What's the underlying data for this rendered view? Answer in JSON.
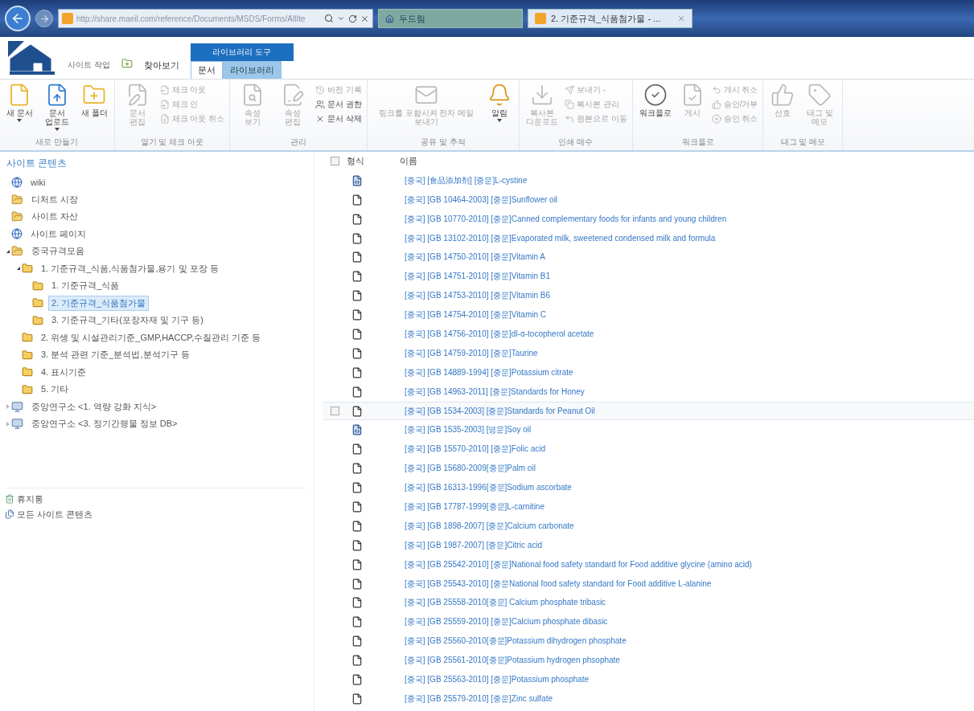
{
  "browser": {
    "address": "http://share.maeil.com/reference/Documents/MSDS/Forms/AllIte",
    "tabs": [
      {
        "label": "두드림",
        "selected": false
      },
      {
        "label": "2. 기준규격_식품첨가물 - ...",
        "selected": true
      }
    ]
  },
  "ribbon": {
    "site_actions": "사이트 작업",
    "browse": "찾아보기",
    "tool_group": "라이브러리 도구",
    "tabs": [
      {
        "label": "문서",
        "selected": true
      },
      {
        "label": "라이브러리",
        "selected": false
      }
    ],
    "groups": [
      {
        "label": "새로 만들기",
        "items": [
          {
            "kind": "large",
            "label": "새 문서",
            "dropdown": true,
            "disabled": false
          },
          {
            "kind": "large",
            "label": "문서 업로드",
            "dropdown": true,
            "disabled": false
          },
          {
            "kind": "large",
            "label": "새 폴더",
            "dropdown": false,
            "disabled": false
          }
        ]
      },
      {
        "label": "열기 및 체크 아웃",
        "items": [
          {
            "kind": "large",
            "label": "문서 편집",
            "dropdown": false,
            "disabled": true
          },
          {
            "kind": "small",
            "label": "체크 아웃",
            "dropdown": false,
            "disabled": true
          },
          {
            "kind": "small",
            "label": "체크 인",
            "dropdown": false,
            "disabled": true
          },
          {
            "kind": "small",
            "label": "체크 아웃 취소",
            "dropdown": false,
            "disabled": true
          }
        ]
      },
      {
        "label": "관리",
        "items": [
          {
            "kind": "large",
            "label": "속성 보기",
            "dropdown": false,
            "disabled": true
          },
          {
            "kind": "large",
            "label": "속성 편집",
            "dropdown": false,
            "disabled": true
          },
          {
            "kind": "small",
            "label": "버전 기록",
            "dropdown": false,
            "disabled": true
          },
          {
            "kind": "small",
            "label": "문서 권한",
            "dropdown": false,
            "disabled": false
          },
          {
            "kind": "small",
            "label": "문서 삭제",
            "dropdown": false,
            "disabled": false
          }
        ]
      },
      {
        "label": "공유 및 추적",
        "items": [
          {
            "kind": "large",
            "label": "링크를 포함시켜 전자 메일 보내기",
            "dropdown": false,
            "disabled": true
          },
          {
            "kind": "large",
            "label": "알림",
            "dropdown": true,
            "disabled": false
          }
        ]
      },
      {
        "label": "인쇄 매수",
        "items": [
          {
            "kind": "large",
            "label": "복사본 다운로드",
            "dropdown": false,
            "disabled": true
          },
          {
            "kind": "small",
            "label": "보내기 -",
            "dropdown": false,
            "disabled": true
          },
          {
            "kind": "small",
            "label": "복사본 관리",
            "dropdown": false,
            "disabled": true
          },
          {
            "kind": "small",
            "label": "원본으로 이동",
            "dropdown": false,
            "disabled": true
          }
        ]
      },
      {
        "label": "워크플로",
        "items": [
          {
            "kind": "large",
            "label": "워크플로",
            "dropdown": false,
            "disabled": false
          },
          {
            "kind": "large",
            "label": "게시",
            "dropdown": false,
            "disabled": true
          },
          {
            "kind": "small",
            "label": "게시 취소",
            "dropdown": false,
            "disabled": true
          },
          {
            "kind": "small",
            "label": "승인/거부",
            "dropdown": false,
            "disabled": true
          },
          {
            "kind": "small",
            "label": "승인 취소",
            "dropdown": false,
            "disabled": true
          }
        ]
      },
      {
        "label": "태그 및 메모",
        "items": [
          {
            "kind": "large",
            "label": "선호",
            "dropdown": false,
            "disabled": true
          },
          {
            "kind": "large",
            "label": "태그 및 메모",
            "dropdown": false,
            "disabled": true
          }
        ]
      }
    ]
  },
  "nav": {
    "heading": "사이트 콘텐츠",
    "items": [
      {
        "kind": "page",
        "label": "wiki",
        "selected": false
      },
      {
        "kind": "library",
        "label": "디처트 시장",
        "selected": false
      },
      {
        "kind": "library",
        "label": "사이트 자산",
        "selected": false
      },
      {
        "kind": "page",
        "label": "사이트 페이지",
        "selected": false
      },
      {
        "kind": "library",
        "label": "중국규격모음",
        "selected": false,
        "expanded": true,
        "children": [
          {
            "kind": "folder",
            "label": "1. 기준규격_식품,식품첨가물,용기 및 포장 등",
            "selected": false,
            "expanded": true,
            "children": [
              {
                "kind": "folder",
                "label": "1. 기준규격_식품",
                "selected": false
              },
              {
                "kind": "folder",
                "label": "2. 기준규격_식품첨가물",
                "selected": true
              },
              {
                "kind": "folder",
                "label": "3. 기준규격_기타(포장자재 및 기구 등)",
                "selected": false
              }
            ]
          },
          {
            "kind": "folder",
            "label": "2. 위생 및 시설관리기준_GMP,HACCP,수질관리 기준 등",
            "selected": false
          },
          {
            "kind": "folder",
            "label": "3. 분석 관련 기준_분석법,분석기구 등",
            "selected": false
          },
          {
            "kind": "folder",
            "label": "4. 표시기준",
            "selected": false
          },
          {
            "kind": "folder",
            "label": "5. 기타",
            "selected": false
          }
        ]
      },
      {
        "kind": "site",
        "label": "중앙연구소 <1. 역량 강화 지식>",
        "selected": false,
        "expanded": false
      },
      {
        "kind": "site",
        "label": "중앙연구소 <3. 정기간행물 정보 DB>",
        "selected": false,
        "expanded": false
      }
    ],
    "footer": [
      "휴지통",
      "모든 사이트 콘텐츠"
    ]
  },
  "list": {
    "select_all": {
      "checked": false
    },
    "columns": [
      "형식",
      "이름"
    ],
    "rows": [
      {
        "kind": "html",
        "name": "[중국] [食品添加剂] [중문]L-cystine",
        "hovered": false
      },
      {
        "kind": "doc",
        "name": "[중국] [GB 10464-2003] [중문]Sunflower oil",
        "hovered": false
      },
      {
        "kind": "doc",
        "name": "[중국] [GB 10770-2010] [중문]Canned complementary foods for infants and young children",
        "hovered": false
      },
      {
        "kind": "doc",
        "name": "[중국] [GB 13102-2010] [중문]Evaporated milk, sweetened condensed milk and formula",
        "hovered": false
      },
      {
        "kind": "doc",
        "name": "[중국] [GB 14750-2010] [중문]Vitamin A",
        "hovered": false
      },
      {
        "kind": "doc",
        "name": "[중국] [GB 14751-2010] [중문]Vitamin B1",
        "hovered": false
      },
      {
        "kind": "doc",
        "name": "[중국] [GB 14753-2010] [중문]Vitamin B6",
        "hovered": false
      },
      {
        "kind": "doc",
        "name": "[중국] [GB 14754-2010] [중문]Vitamin C",
        "hovered": false
      },
      {
        "kind": "doc",
        "name": "[중국] [GB 14756-2010] [중문]dl-α-tocopherol acetate",
        "hovered": false
      },
      {
        "kind": "doc",
        "name": "[중국] [GB 14759-2010] [중문]Taurine",
        "hovered": false
      },
      {
        "kind": "doc",
        "name": "[중국] [GB 14889-1994] [중문]Potassium citrate",
        "hovered": false
      },
      {
        "kind": "doc",
        "name": "[중국] [GB 14963-2011] [중문]Standards for Honey",
        "hovered": false
      },
      {
        "kind": "doc",
        "name": "[중국] [GB 1534-2003] [중문]Standards for Peanut Oil",
        "hovered": true
      },
      {
        "kind": "html",
        "name": "[중국] [GB 1535-2003] [영문]Soy oil",
        "hovered": false
      },
      {
        "kind": "doc",
        "name": "[중국] [GB 15570-2010] [중문]Folic acid",
        "hovered": false
      },
      {
        "kind": "doc",
        "name": "[중국] [GB 15680-2009[중문]Palm oil",
        "hovered": false
      },
      {
        "kind": "doc",
        "name": "[중국] [GB 16313-1996[중문]Sodium ascorbate",
        "hovered": false
      },
      {
        "kind": "doc",
        "name": "[중국] [GB 17787-1999[중문]L-carnitine",
        "hovered": false
      },
      {
        "kind": "doc",
        "name": "[중국] [GB 1898-2007] [중문]Calcium carbonate",
        "hovered": false
      },
      {
        "kind": "doc",
        "name": "[중국] [GB 1987-2007] [중문]Citric acid",
        "hovered": false
      },
      {
        "kind": "doc",
        "name": "[중국] [GB 25542-2010] [중문]National food safety standard for Food additive glycine (amino acid)",
        "hovered": false
      },
      {
        "kind": "doc",
        "name": "[중국] [GB 25543-2010] [중문National food safety standard for Food additive L-alanine",
        "hovered": false
      },
      {
        "kind": "doc",
        "name": "[중국] [GB 25558-2010[중문] Calcium phosphate tribasic",
        "hovered": false
      },
      {
        "kind": "doc",
        "name": "[중국] [GB 25559-2010] [중문]Calcium phosphate dibasic",
        "hovered": false
      },
      {
        "kind": "doc",
        "name": "[중국] [GB 25560-2010[중문]Potassium dihydrogen phosphate",
        "hovered": false
      },
      {
        "kind": "doc",
        "name": "[중국] [GB 25561-2010[중문]Potassium hydrogen phsophate",
        "hovered": false
      },
      {
        "kind": "doc",
        "name": "[중국] [GB 25563-2010] [중문]Potassium phosphate",
        "hovered": false
      },
      {
        "kind": "doc",
        "name": "[중국] [GB 25579-2010] [중문]Zinc sulfate",
        "hovered": false
      }
    ]
  }
}
